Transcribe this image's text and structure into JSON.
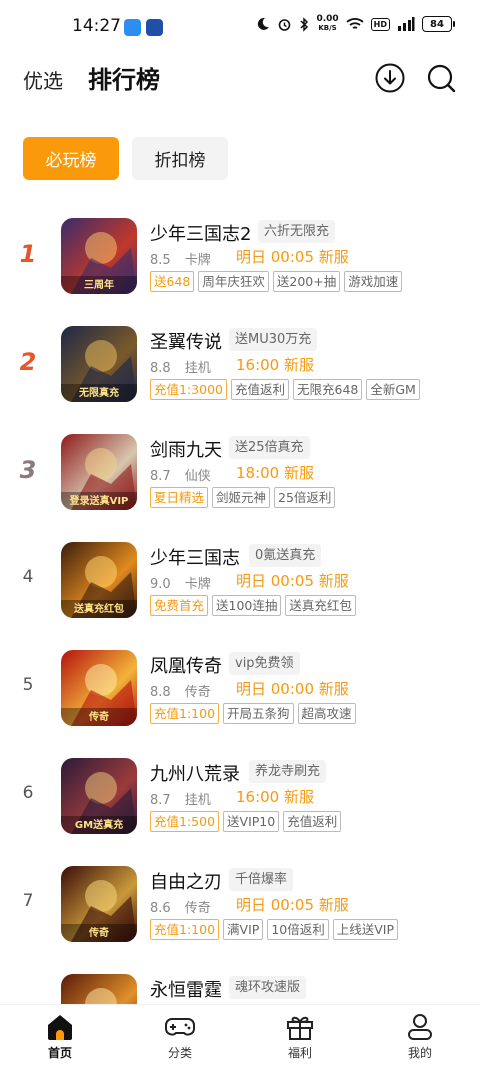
{
  "status_bar": {
    "time": "14:27",
    "net_speed_value": "0.00",
    "net_speed_unit": "KB/S",
    "hd": "HD",
    "battery": "84"
  },
  "header": {
    "tab_featured": "优选",
    "tab_ranking": "排行榜"
  },
  "segments": {
    "must_play": "必玩榜",
    "discount": "折扣榜"
  },
  "games": [
    {
      "rank": "1",
      "name": "少年三国志2",
      "badge": "六折无限充",
      "score": "8.5",
      "category": "卡牌",
      "time": "明日 00:05 新服",
      "tags": [
        "送648",
        "周年庆狂欢",
        "送200+抽",
        "游戏加速"
      ],
      "thumb_text": "三周年",
      "colors": [
        "#3a2b6b",
        "#c0392b",
        "#f5c16c"
      ]
    },
    {
      "rank": "2",
      "name": "圣翼传说",
      "badge": "送MU30万充",
      "score": "8.8",
      "category": "挂机",
      "time": "16:00 新服",
      "tags": [
        "充值1:3000",
        "充值返利",
        "无限充648",
        "全新GM"
      ],
      "thumb_text": "无限真充",
      "colors": [
        "#1e2748",
        "#7a5a2a",
        "#e6b85c"
      ]
    },
    {
      "rank": "3",
      "name": "剑雨九天",
      "badge": "送25倍真充",
      "score": "8.7",
      "category": "仙侠",
      "time": "18:00 新服",
      "tags": [
        "夏日精选",
        "剑姬元神",
        "25倍返利"
      ],
      "thumb_text": "登录送真VIP",
      "colors": [
        "#8e1b1b",
        "#d8c6b0",
        "#f0d28a"
      ]
    },
    {
      "rank": "4",
      "name": "少年三国志",
      "badge": "0氪送真充",
      "score": "9.0",
      "category": "卡牌",
      "time": "明日 00:05 新服",
      "tags": [
        "免费首充",
        "送100连抽",
        "送真充红包"
      ],
      "thumb_text": "送真充红包",
      "colors": [
        "#3b1d0e",
        "#e08a1e",
        "#ffd36b"
      ]
    },
    {
      "rank": "5",
      "name": "凤凰传奇",
      "badge": "vip免费领",
      "score": "8.8",
      "category": "传奇",
      "time": "明日 00:00 新服",
      "tags": [
        "充值1:100",
        "开局五条狗",
        "超高攻速"
      ],
      "thumb_text": "传奇",
      "colors": [
        "#b5120f",
        "#f2b43a",
        "#ffe9a8"
      ]
    },
    {
      "rank": "6",
      "name": "九州八荒录",
      "badge": "养龙寺刷充",
      "score": "8.7",
      "category": "挂机",
      "time": "16:00 新服",
      "tags": [
        "充值1:500",
        "送VIP10",
        "充值返利"
      ],
      "thumb_text": "GM送真充",
      "colors": [
        "#2c1a3a",
        "#9b3b3b",
        "#e8c27a"
      ]
    },
    {
      "rank": "7",
      "name": "自由之刃",
      "badge": "千倍爆率",
      "score": "8.6",
      "category": "传奇",
      "time": "明日 00:05 新服",
      "tags": [
        "充值1:100",
        "满VIP",
        "10倍返利",
        "上线送VIP"
      ],
      "thumb_text": "传奇",
      "colors": [
        "#3a0d0a",
        "#c99a3a",
        "#f5d67a"
      ]
    },
    {
      "rank": "",
      "name": "永恒雷霆",
      "badge": "魂环攻速版",
      "score": "",
      "category": "",
      "time": "",
      "tags": [],
      "thumb_text": "",
      "colors": [
        "#5a1a0a",
        "#e0902a",
        "#ffe0a0"
      ]
    }
  ],
  "bottom_nav": [
    {
      "label": "首页",
      "icon": "home-icon",
      "active": true
    },
    {
      "label": "分类",
      "icon": "gamepad-icon",
      "active": false
    },
    {
      "label": "福利",
      "icon": "gift-icon",
      "active": false
    },
    {
      "label": "我的",
      "icon": "user-icon",
      "active": false
    }
  ],
  "accent": "#fa9a0a",
  "rank_colors": [
    "#e8552b",
    "#e8552b",
    "#8a7a7a"
  ]
}
